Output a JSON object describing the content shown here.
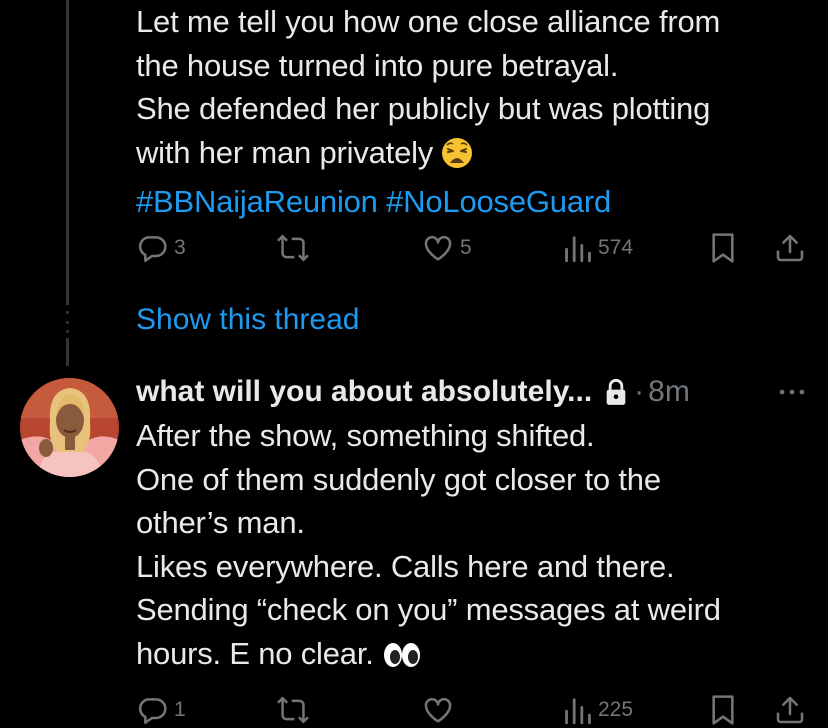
{
  "tweet1": {
    "lines": [
      "Let me tell you how one close alliance from",
      "the house turned into pure betrayal.",
      "She defended her publicly but was plotting",
      "with her man privately"
    ],
    "hashtags": "#BBNaijaReunion #NoLooseGuard",
    "emoji": "weary-face",
    "actions": {
      "replies": "3",
      "reposts": "",
      "likes": "5",
      "views": "574"
    }
  },
  "show_thread_label": "Show this thread",
  "tweet2": {
    "display_name": "what will you about absolutely...",
    "separator": "·",
    "time": "8m",
    "lines": [
      "After the show, something shifted.",
      "One of them suddenly got closer to the",
      "other’s man.",
      "Likes everywhere. Calls here and there.",
      "Sending “check on you” messages at weird",
      "hours. E no clear."
    ],
    "emoji": "eyes",
    "actions": {
      "replies": "1",
      "reposts": "",
      "likes": "",
      "views": "225"
    }
  },
  "icons": {
    "reply": "reply-icon",
    "repost": "repost-icon",
    "like": "heart-icon",
    "views": "views-icon",
    "bookmark": "bookmark-icon",
    "share": "share-icon",
    "lock": "lock-icon",
    "more": "more-icon"
  },
  "colors": {
    "background": "#000000",
    "text": "#e7e9ea",
    "muted": "#71767b",
    "accent": "#1d9bf0",
    "thread_line": "#333639"
  }
}
